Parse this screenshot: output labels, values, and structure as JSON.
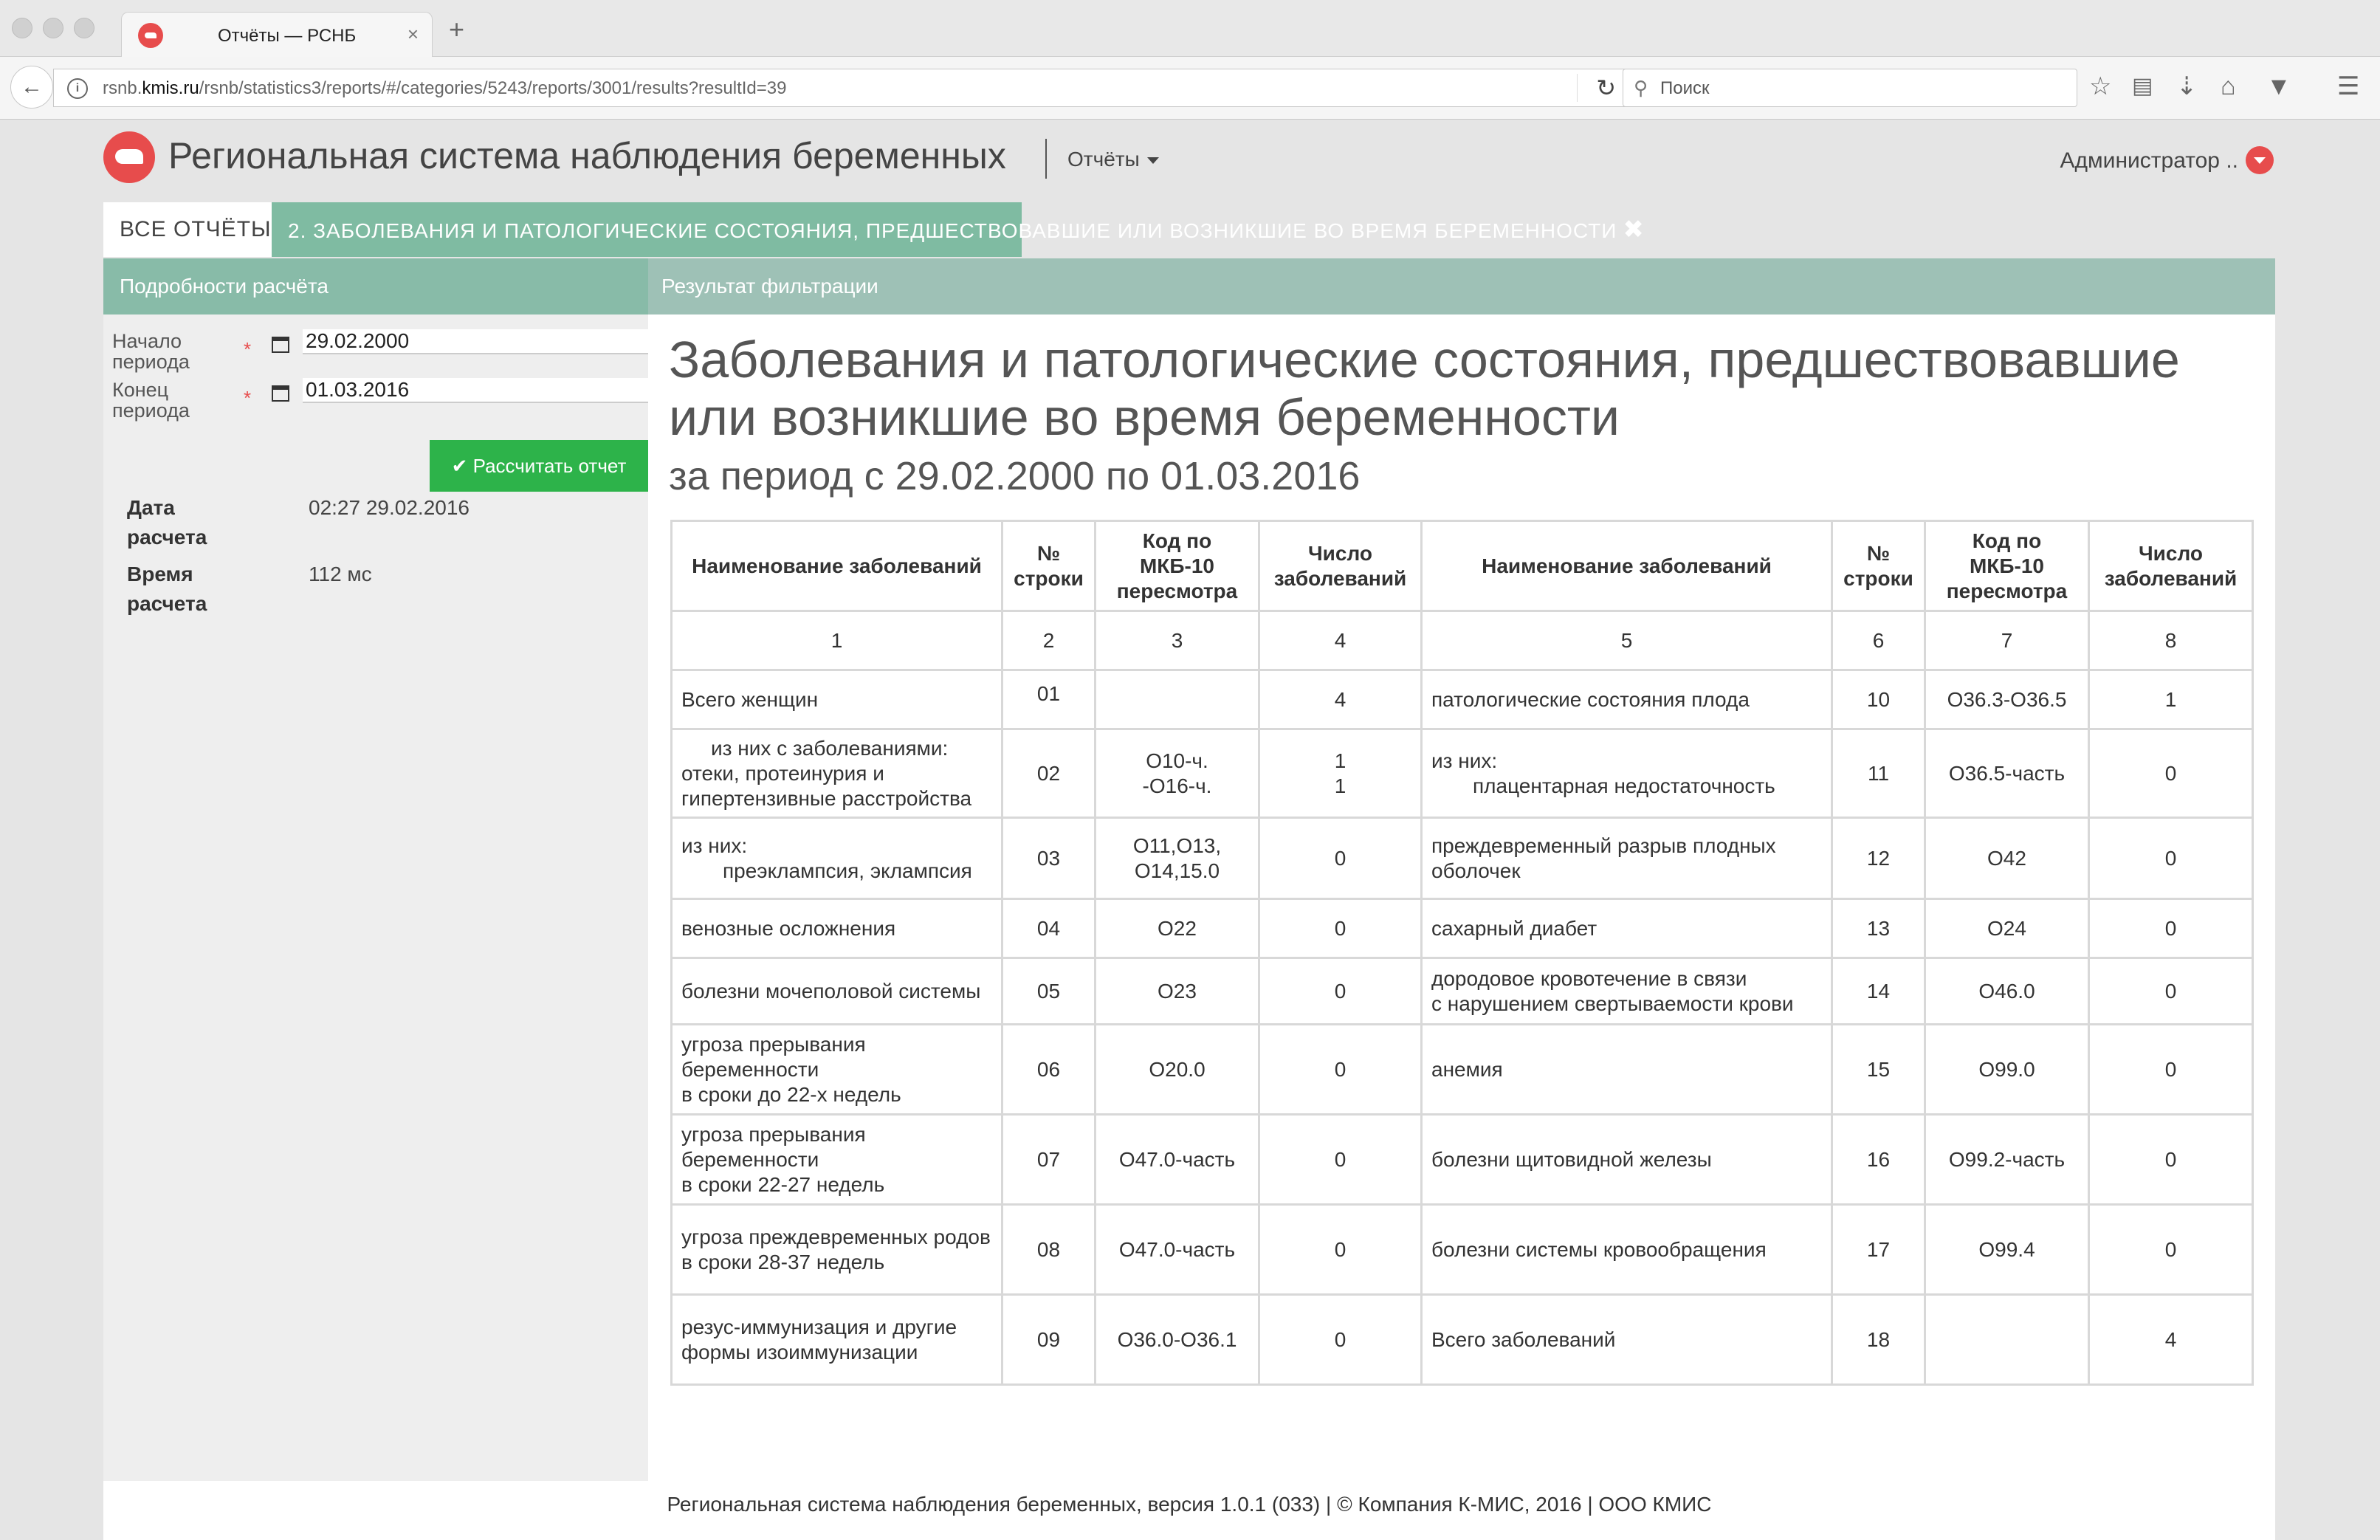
{
  "browser": {
    "tab_title": "Отчёты — РСНБ",
    "tab_close": "×",
    "new_tab": "+",
    "url_prefix": "rsnb.",
    "url_host": "kmis.ru",
    "url_path": "/rsnb/statistics3/reports/#/categories/5243/reports/3001/results?resultId=39",
    "search_placeholder": "Поиск"
  },
  "app": {
    "title": "Региональная система наблюдения беременных",
    "menu_label": "Отчёты",
    "user_label": "Администратор .."
  },
  "tabs": {
    "all": "ВСЕ ОТЧЁТЫ",
    "active": "2. ЗАБОЛЕВАНИЯ И ПАТОЛОГИЧЕСКИЕ СОСТОЯНИЯ, ПРЕДШЕСТВОВАВШИЕ ИЛИ ВОЗНИКШИЕ ВО ВРЕМЯ БЕРЕМЕННОСТИ",
    "close": "✖"
  },
  "left_panel": {
    "header": "Подробности расчёта",
    "start_label_1": "Начало",
    "start_label_2": "периода",
    "start_value": "29.02.2000",
    "end_label_1": "Конец",
    "end_label_2": "периода",
    "end_value": "01.03.2016",
    "required_mark": "*",
    "calc_button": "✔ Рассчитать отчет",
    "calc_date_key_1": "Дата",
    "calc_date_key_2": "расчета",
    "calc_date_value": "02:27 29.02.2016",
    "calc_time_key_1": "Время",
    "calc_time_key_2": "расчета",
    "calc_time_value": "112 мс"
  },
  "right_panel": {
    "header": "Результат фильтрации",
    "title_line1": "Заболевания и патологические состояния, предшествовавшие",
    "title_line2": "или возникшие во время беременности",
    "subtitle": "за период с 29.02.2000 по 01.03.2016"
  },
  "table": {
    "headers": {
      "name": "Наименование заболеваний",
      "row_no": "№ строки",
      "mkb": "Код по МКБ-10 пересмотра",
      "count": "Число заболеваний",
      "name2": "Наименование заболеваний",
      "row_no2": "№ строки",
      "mkb2": "Код по МКБ-10 пересмотра",
      "count2": "Число заболеваний"
    },
    "col_numbers": [
      "1",
      "2",
      "3",
      "4",
      "5",
      "6",
      "7",
      "8"
    ],
    "rows": [
      {
        "n1": "Всего женщин",
        "r1": "01",
        "k1": "",
        "c1": "4",
        "n2": "патологические состояния плода",
        "r2": "10",
        "k2": "О36.3-О36.5",
        "c2": "1"
      },
      {
        "n1a": "из них с заболеваниями:",
        "n1b": "отеки, протеинурия и гипертензивные расстройства",
        "r1": "02",
        "k1a": "О10-ч.",
        "k1b": "-О16-ч.",
        "c1a": "1",
        "c1b": "1",
        "n2a": "из них:",
        "n2b": "плацентарная недостаточность",
        "r2": "11",
        "k2": "О36.5-часть",
        "c2": "0"
      },
      {
        "n1a": "из них:",
        "n1b": "преэклампсия, эклампсия",
        "r1": "03",
        "k1": "О11,О13, О14,15.0",
        "c1": "0",
        "n2": "преждевременный разрыв плодных оболочек",
        "r2": "12",
        "k2": "О42",
        "c2": "0"
      },
      {
        "n1": "венозные осложнения",
        "r1": "04",
        "k1": "О22",
        "c1": "0",
        "n2": "сахарный диабет",
        "r2": "13",
        "k2": "О24",
        "c2": "0"
      },
      {
        "n1": "болезни мочеполовой системы",
        "r1": "05",
        "k1": "О23",
        "c1": "0",
        "n2a": "дородовое кровотечение в связи",
        "n2b": "с нарушением свертываемости крови",
        "r2": "14",
        "k2": "О46.0",
        "c2": "0"
      },
      {
        "n1a": "угроза прерывания беременности",
        "n1b": "в сроки до 22-х недель",
        "r1": "06",
        "k1": "О20.0",
        "c1": "0",
        "n2": "анемия",
        "r2": "15",
        "k2": "О99.0",
        "c2": "0"
      },
      {
        "n1a": "угроза прерывания беременности",
        "n1b": "в сроки 22-27 недель",
        "r1": "07",
        "k1": "О47.0-часть",
        "c1": "0",
        "n2": "болезни щитовидной железы",
        "r2": "16",
        "k2": "О99.2-часть",
        "c2": "0"
      },
      {
        "n1a": "угроза преждевременных родов",
        "n1b": "в сроки 28-37 недель",
        "r1": "08",
        "k1": "О47.0-часть",
        "c1": "0",
        "n2": "болезни системы кровообращения",
        "r2": "17",
        "k2": "О99.4",
        "c2": "0"
      },
      {
        "n1": "резус-иммунизация и другие формы изоиммунизации",
        "r1": "09",
        "k1": "О36.0-О36.1",
        "c1": "0",
        "n2": "Всего заболеваний",
        "r2": "18",
        "k2": "",
        "c2": "4"
      }
    ]
  },
  "footer": "Региональная система наблюдения беременных, версия 1.0.1 (033) | © Компания К-МИС, 2016 | ООО КМИС"
}
